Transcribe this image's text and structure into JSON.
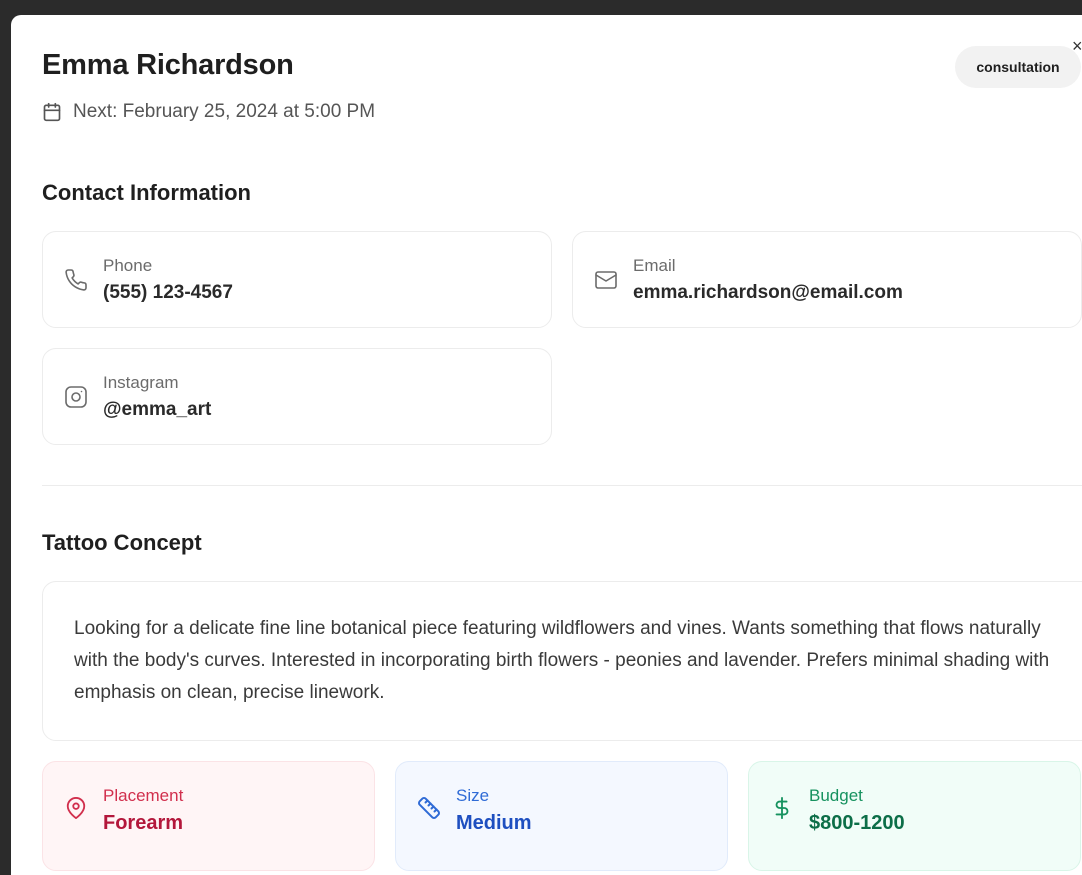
{
  "client": {
    "name": "Emma Richardson",
    "status_badge": "consultation",
    "next_appointment": "Next: February 25, 2024 at 5:00 PM"
  },
  "close_label": "×",
  "contact": {
    "section_title": "Contact Information",
    "phone": {
      "label": "Phone",
      "value": "(555) 123-4567",
      "icon": "phone-icon"
    },
    "email": {
      "label": "Email",
      "value": "emma.richardson@email.com",
      "icon": "mail-icon"
    },
    "instagram": {
      "label": "Instagram",
      "value": "@emma_art",
      "icon": "instagram-icon"
    }
  },
  "concept": {
    "section_title": "Tattoo Concept",
    "description": "Looking for a delicate fine line botanical piece featuring wildflowers and vines. Wants something that flows naturally with the body's curves. Interested in incorporating birth flowers - peonies and lavender. Prefers minimal shading with emphasis on clean, precise linework."
  },
  "details": {
    "placement": {
      "label": "Placement",
      "value": "Forearm",
      "icon": "map-pin-icon",
      "color": "#d12f4d"
    },
    "size": {
      "label": "Size",
      "value": "Medium",
      "icon": "ruler-icon",
      "color": "#2f6bd6"
    },
    "budget": {
      "label": "Budget",
      "value": "$800-1200",
      "icon": "dollar-icon",
      "color": "#16925f"
    }
  }
}
